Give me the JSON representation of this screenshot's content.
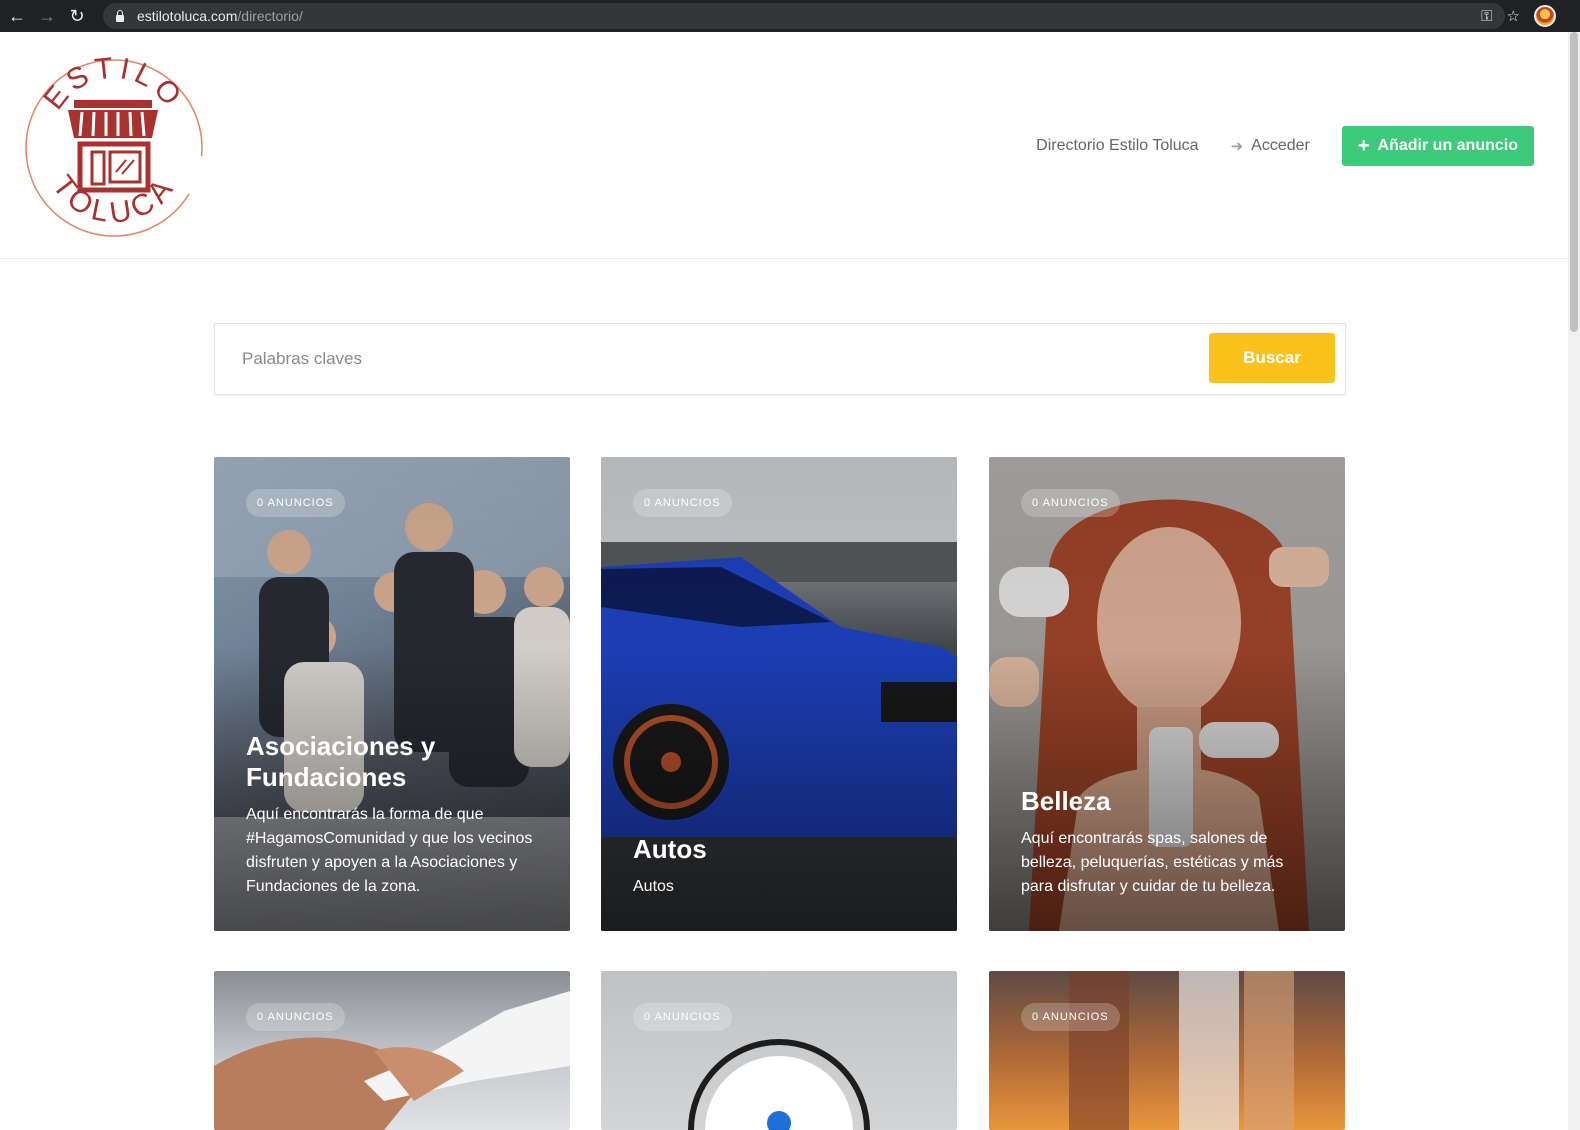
{
  "browser": {
    "url_host": "estilotoluca.com",
    "url_path": "/directorio/"
  },
  "header": {
    "logo": {
      "top_text": "ESTILO",
      "bottom_text": "TOLUCA",
      "brand_color": "#a8322f"
    },
    "nav": {
      "directory_label": "Directorio Estilo Toluca",
      "login_label": "Acceder",
      "add_listing_label": "Añadir un anuncio"
    }
  },
  "search": {
    "placeholder": "Palabras claves",
    "button_label": "Buscar"
  },
  "colors": {
    "accent_green": "#3dca7a",
    "accent_yellow": "#fbc21c"
  },
  "categories": [
    {
      "badge": "0 ANUNCIOS",
      "title": "Asociaciones y Fundaciones",
      "description": "Aquí encontrarás la forma de que #HagamosComunidad y que los vecinos disfruten y apoyen a la Asociaciones y Fundaciones de la zona."
    },
    {
      "badge": "0 ANUNCIOS",
      "title": "Autos",
      "description": "Autos"
    },
    {
      "badge": "0 ANUNCIOS",
      "title": "Belleza",
      "description": "Aquí encontrarás spas, salones de belleza, peluquerías, estéticas y más para disfrutar y cuidar de tu belleza."
    },
    {
      "badge": "0 ANUNCIOS"
    },
    {
      "badge": "0 ANUNCIOS"
    },
    {
      "badge": "0 ANUNCIOS"
    }
  ]
}
